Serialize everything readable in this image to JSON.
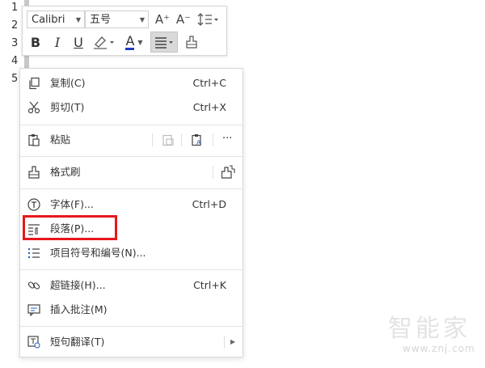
{
  "gutter": {
    "lines": [
      "1",
      "2",
      "3",
      "4",
      "5"
    ]
  },
  "mini_toolbar": {
    "font_name": "Calibri",
    "font_size": "五号",
    "grow_font_icon": "A⁺",
    "shrink_font_icon": "A⁻",
    "bold": "B",
    "italic": "I",
    "underline": "U",
    "font_color_letter": "A",
    "font_color": "#1f3cc6"
  },
  "menu": {
    "copy": {
      "label": "复制(C)",
      "shortcut": "Ctrl+C"
    },
    "cut": {
      "label": "剪切(T)",
      "shortcut": "Ctrl+X"
    },
    "paste": {
      "label": "粘贴",
      "more": "···"
    },
    "format_painter": {
      "label": "格式刷"
    },
    "font": {
      "label": "字体(F)...",
      "shortcut": "Ctrl+D"
    },
    "paragraph": {
      "label": "段落(P)..."
    },
    "bullets": {
      "label": "项目符号和编号(N)..."
    },
    "hyperlink": {
      "label": "超链接(H)...",
      "shortcut": "Ctrl+K"
    },
    "comment": {
      "label": "插入批注(M)"
    },
    "translate": {
      "label": "短句翻译(T)"
    }
  },
  "highlight_color": "#e8171c",
  "watermark": {
    "brand": "智能家",
    "url": "www.znj.com"
  }
}
